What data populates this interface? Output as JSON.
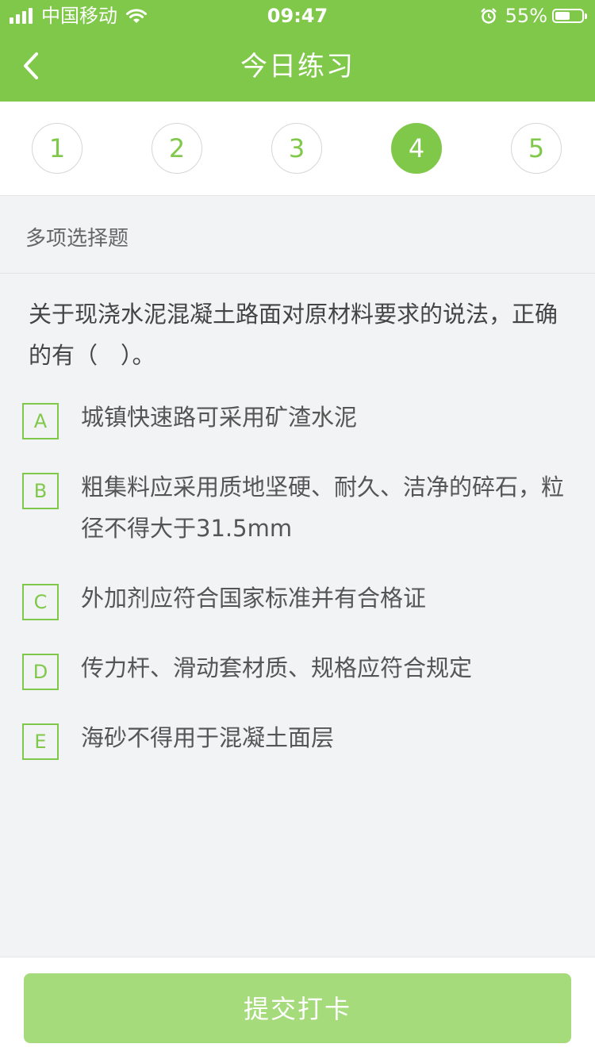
{
  "status_bar": {
    "carrier": "中国移动",
    "time": "09:47",
    "battery_pct": "55%",
    "battery_level": 0.55
  },
  "header": {
    "title": "今日练习",
    "back_icon": "chevron-left-icon"
  },
  "steps": {
    "items": [
      "1",
      "2",
      "3",
      "4",
      "5"
    ],
    "active": "4"
  },
  "question": {
    "type": "多项选择题",
    "text": "关于现浇水泥混凝土路面对原材料要求的说法，正确的有（　）。",
    "options": [
      {
        "letter": "A",
        "text": "城镇快速路可采用矿渣水泥"
      },
      {
        "letter": "B",
        "text": "粗集料应采用质地坚硬、耐久、洁净的碎石，粒径不得大于31.5mm"
      },
      {
        "letter": "C",
        "text": "外加剂应符合国家标准并有合格证"
      },
      {
        "letter": "D",
        "text": "传力杆、滑动套材质、规格应符合规定"
      },
      {
        "letter": "E",
        "text": "海砂不得用于混凝土面层"
      }
    ]
  },
  "footer": {
    "submit_label": "提交打卡"
  },
  "colors": {
    "accent": "#80c84a",
    "button_disabled": "#a6db7b",
    "background": "#f2f3f5"
  }
}
